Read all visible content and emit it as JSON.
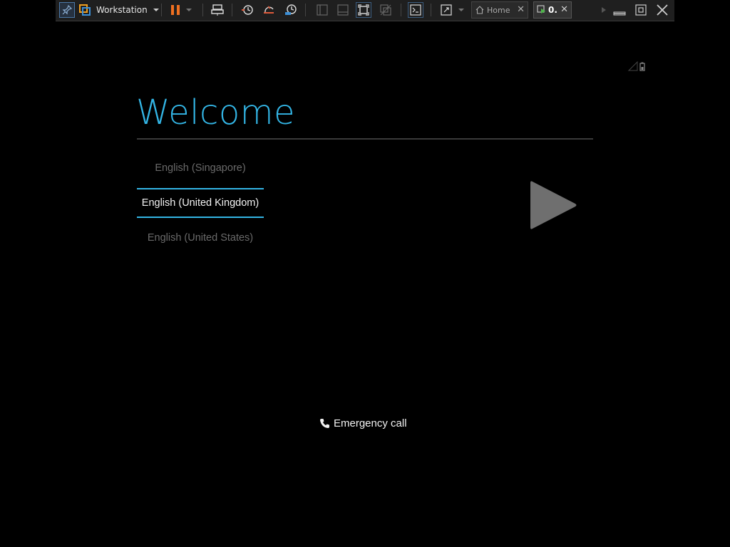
{
  "toolbar": {
    "app_label": "Workstation",
    "tabs": [
      {
        "label": "Home",
        "active": false
      },
      {
        "label": "0.",
        "active": true
      }
    ],
    "accent_color": "#4a78a8"
  },
  "icons": {
    "pin": "pin-icon",
    "vmware_logo": "vmware-logo-icon",
    "pause": "pause-icon",
    "send_ctrl_alt_del": "send-keys-icon",
    "snapshot_take": "snapshot-icon",
    "snapshot_revert": "snapshot-revert-icon",
    "snapshot_manager": "snapshot-manager-icon",
    "show_library": "library-icon",
    "show_thumbnails": "thumbnail-bar-icon",
    "fit_guest": "fit-guest-icon",
    "unity": "unity-icon",
    "console": "console-icon",
    "full_screen": "full-screen-icon",
    "home": "home-icon",
    "vm_tab": "vm-running-icon",
    "scroll_right": "scroll-right-icon",
    "minimize": "minimize-icon",
    "restore": "restore-icon",
    "close": "close-icon"
  },
  "screen": {
    "title": "Welcome",
    "title_color": "#33b5e5",
    "languages": [
      {
        "label": "English (Singapore)",
        "selected": false
      },
      {
        "label": "English (United Kingdom)",
        "selected": true
      },
      {
        "label": "English (United States)",
        "selected": false
      }
    ],
    "start_icon": "play-arrow-icon",
    "emergency_label": "Emergency call",
    "status_icons": [
      "signal-icon",
      "battery-icon"
    ]
  }
}
